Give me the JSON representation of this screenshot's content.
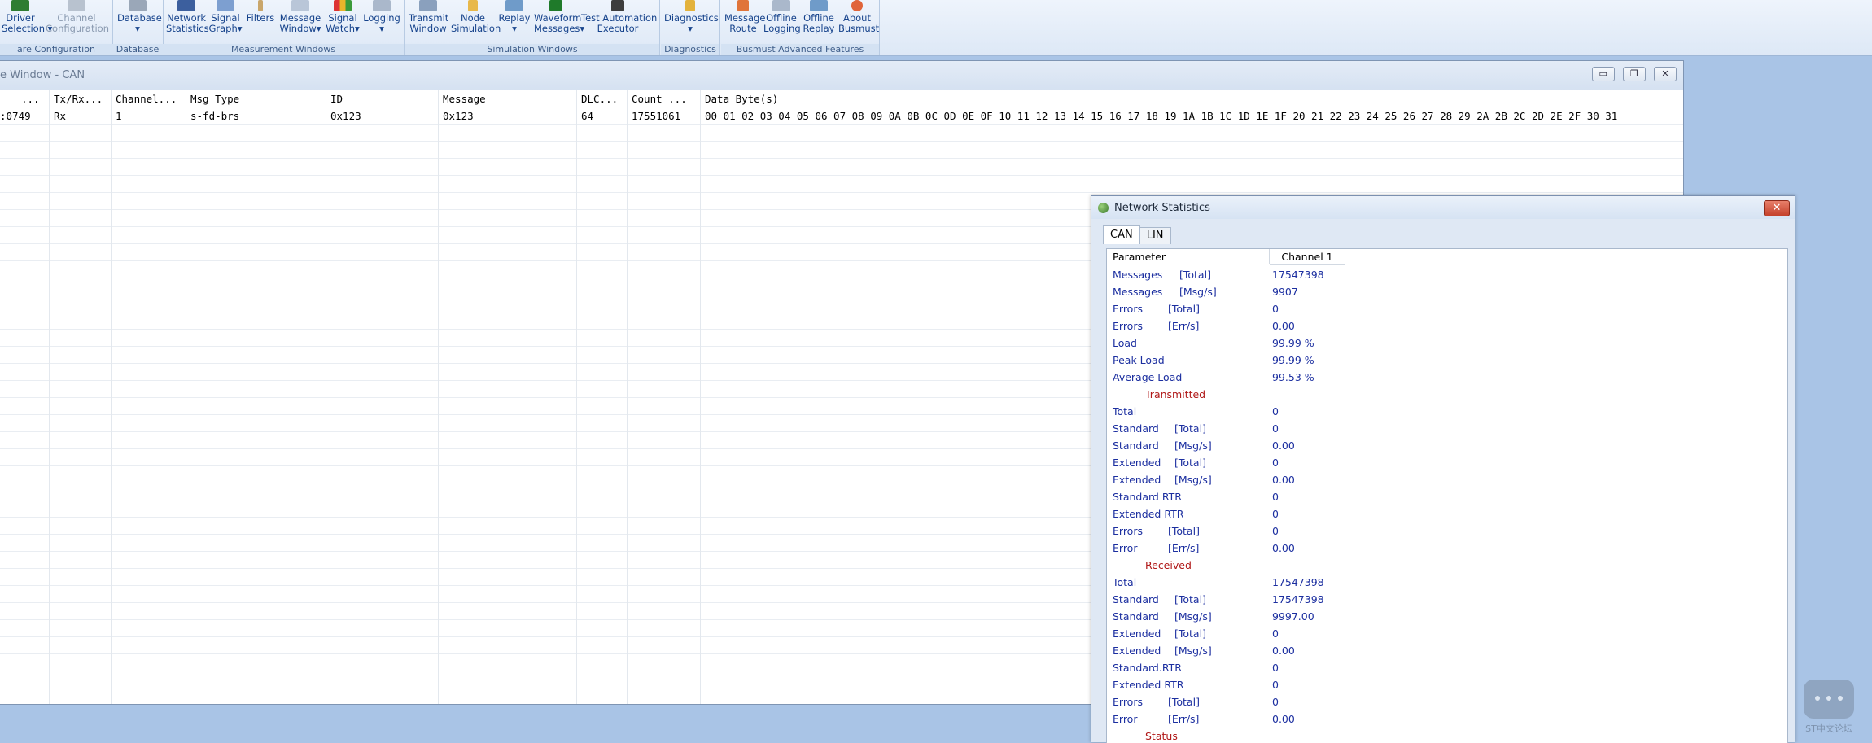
{
  "ribbon": {
    "groups": [
      {
        "label": "are Configuration",
        "buttons": [
          {
            "line1": "Driver",
            "line2": "Selection",
            "icon": "driver-icon",
            "dropdown": true
          },
          {
            "line1": "Channel",
            "line2": "Configuration",
            "icon": "channel-config-icon",
            "disabled": true
          }
        ]
      },
      {
        "label": "Database",
        "buttons": [
          {
            "line1": "Database",
            "line2": "",
            "icon": "database-icon",
            "dropdown": true
          }
        ]
      },
      {
        "label": "Measurement Windows",
        "buttons": [
          {
            "line1": "Network",
            "line2": "Statistics",
            "icon": "network-statistics-icon"
          },
          {
            "line1": "Signal",
            "line2": "Graph",
            "icon": "signal-graph-icon",
            "dropdown": true
          },
          {
            "line1": "Filters",
            "line2": "",
            "icon": "filters-icon"
          },
          {
            "line1": "Message",
            "line2": "Window",
            "icon": "message-window-icon",
            "dropdown": true
          },
          {
            "line1": "Signal",
            "line2": "Watch",
            "icon": "signal-watch-icon",
            "dropdown": true
          },
          {
            "line1": "Logging",
            "line2": "",
            "icon": "logging-icon",
            "dropdown": true
          }
        ]
      },
      {
        "label": "Simulation Windows",
        "buttons": [
          {
            "line1": "Transmit",
            "line2": "Window",
            "icon": "transmit-icon"
          },
          {
            "line1": "Node",
            "line2": "Simulation",
            "icon": "node-simulation-icon"
          },
          {
            "line1": "Replay",
            "line2": "",
            "icon": "replay-icon",
            "dropdown": true
          },
          {
            "line1": "Waveform",
            "line2": "Messages",
            "icon": "waveform-icon",
            "dropdown": true
          },
          {
            "line1": "Test Automation",
            "line2": "Executor",
            "icon": "test-automation-icon"
          }
        ]
      },
      {
        "label": "Diagnostics",
        "buttons": [
          {
            "line1": "Diagnostics",
            "line2": "",
            "icon": "diagnostics-icon",
            "dropdown": true
          }
        ]
      },
      {
        "label": "Busmust Advanced Features",
        "buttons": [
          {
            "line1": "Message",
            "line2": "Route",
            "icon": "message-route-icon"
          },
          {
            "line1": "Offline",
            "line2": "Logging",
            "icon": "offline-logging-icon"
          },
          {
            "line1": "Offline",
            "line2": "Replay",
            "icon": "offline-replay-icon"
          },
          {
            "line1": "About",
            "line2": "Busmust",
            "icon": "about-icon"
          }
        ]
      }
    ]
  },
  "message_window": {
    "title": "e Window - CAN",
    "buttons": {
      "minimize": "▭",
      "restore": "❐",
      "close": "✕"
    },
    "columns": [
      "...",
      "Tx/Rx...",
      "Channel...",
      "Msg Type",
      "ID",
      "Message",
      "DLC...",
      "Count ...",
      "Data Byte(s)"
    ],
    "rows": [
      [
        ":0749",
        "Rx",
        "1",
        "s-fd-brs",
        "0x123",
        "0x123",
        "64",
        "17551061",
        "00 01 02 03 04 05 06 07 08 09 0A 0B 0C 0D 0E 0F 10 11 12 13 14 15 16 17 18 19 1A 1B 1C 1D 1E 1F 20 21 22 23 24 25 26 27 28 29 2A 2B 2C 2D 2E 2F 30 31"
      ]
    ]
  },
  "network_statistics": {
    "title": "Network Statistics",
    "close": "✕",
    "tabs": [
      "CAN",
      "LIN"
    ],
    "active_tab": "CAN",
    "header": {
      "parameter": "Parameter",
      "channel": "Channel 1"
    },
    "rows": [
      {
        "name": "Messages",
        "unit": "[Total]",
        "value": "17547398"
      },
      {
        "name": "Messages",
        "unit": "[Msg/s]",
        "value": "9907"
      },
      {
        "name": "Errors",
        "unit": "[Total]",
        "value": "0"
      },
      {
        "name": "Errors",
        "unit": "[Err/s]",
        "value": "0.00"
      },
      {
        "name": "Load",
        "unit": "",
        "value": "99.99 %"
      },
      {
        "name": "Peak Load",
        "unit": "",
        "value": "99.99 %"
      },
      {
        "name": "Average Load",
        "unit": "",
        "value": "99.53 %"
      },
      {
        "section": "Transmitted"
      },
      {
        "name": "Total",
        "unit": "",
        "value": "0"
      },
      {
        "name": "Standard",
        "unit": "[Total]",
        "value": "0"
      },
      {
        "name": "Standard",
        "unit": "[Msg/s]",
        "value": "0.00"
      },
      {
        "name": "Extended",
        "unit": "[Total]",
        "value": "0"
      },
      {
        "name": "Extended",
        "unit": "[Msg/s]",
        "value": "0.00"
      },
      {
        "name": "Standard RTR",
        "unit": "",
        "value": "0"
      },
      {
        "name": "Extended RTR",
        "unit": "",
        "value": "0"
      },
      {
        "name": "Errors",
        "unit": "[Total]",
        "value": "0"
      },
      {
        "name": "Error",
        "unit": "[Err/s]",
        "value": "0.00"
      },
      {
        "section": "Received"
      },
      {
        "name": "Total",
        "unit": "",
        "value": "17547398"
      },
      {
        "name": "Standard",
        "unit": "[Total]",
        "value": "17547398"
      },
      {
        "name": "Standard",
        "unit": "[Msg/s]",
        "value": "9997.00"
      },
      {
        "name": "Extended",
        "unit": "[Total]",
        "value": "0"
      },
      {
        "name": "Extended",
        "unit": "[Msg/s]",
        "value": "0.00"
      },
      {
        "name": "Standard.RTR",
        "unit": "",
        "value": "0"
      },
      {
        "name": "Extended RTR",
        "unit": "",
        "value": "0"
      },
      {
        "name": "Errors",
        "unit": "[Total]",
        "value": "0"
      },
      {
        "name": "Error",
        "unit": "[Err/s]",
        "value": "0.00"
      },
      {
        "section": "Status"
      }
    ]
  },
  "watermark": {
    "text": "ST中文论坛",
    "icon": "chat-bubble-icon"
  },
  "colors": {
    "accent": "#15428b",
    "stat_text": "#1c2fa0",
    "section_text": "#b01818",
    "desktop": "#a9c4e6"
  }
}
